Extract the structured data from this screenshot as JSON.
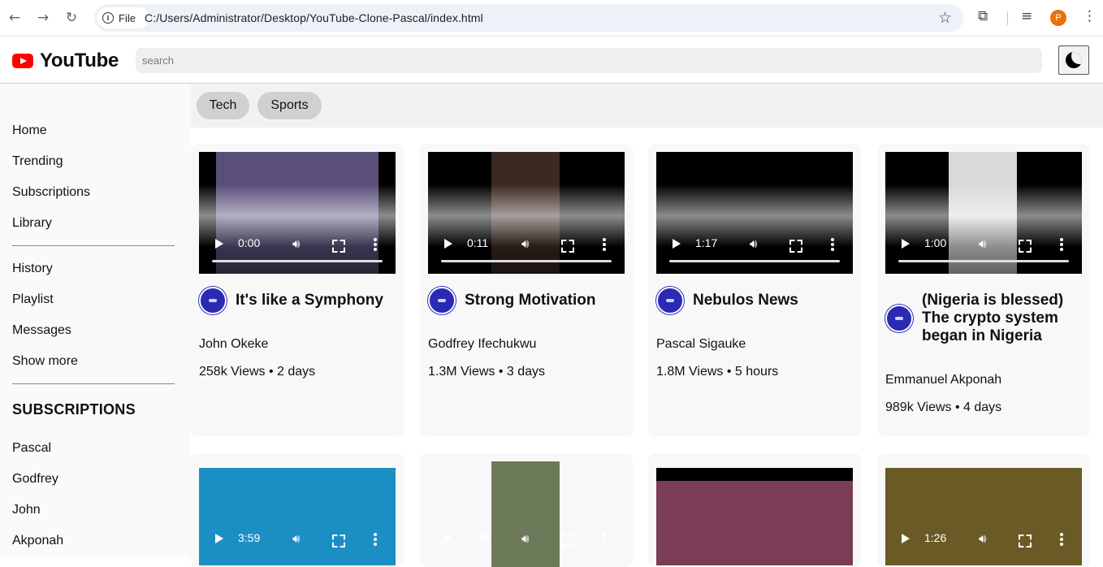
{
  "browser": {
    "file_chip": "File",
    "url": "C:/Users/Administrator/Desktop/YouTube-Clone-Pascal/index.html",
    "profile_initial": "P"
  },
  "header": {
    "brand": "YouTube",
    "search_placeholder": "search"
  },
  "sidebar": {
    "items": [
      "Home",
      "Trending",
      "Subscriptions",
      "Library"
    ],
    "items2": [
      "History",
      "Playlist",
      "Messages",
      "Show more"
    ],
    "subscriptions_heading": "SUBSCRIPTIONS",
    "subscriptions": [
      "Pascal",
      "Godfrey",
      "John",
      "Akponah"
    ]
  },
  "categories": [
    "Tech",
    "Sports"
  ],
  "videos": [
    {
      "time": "0:00",
      "title": "It's like a Symphony",
      "channel": "John Okeke",
      "meta": "258k Views • 2 days",
      "thumb_color": "#5a4f7a"
    },
    {
      "time": "0:11",
      "title": "Strong Motivation",
      "channel": "Godfrey Ifechukwu",
      "meta": "1.3M Views • 3 days",
      "thumb_color": "#3b2a22"
    },
    {
      "time": "1:17",
      "title": "Nebulos News",
      "channel": "Pascal Sigauke",
      "meta": "1.8M Views • 5 hours",
      "thumb_color": "#000000"
    },
    {
      "time": "1:00",
      "title": "(Nigeria is blessed) The crypto system began in Nigeria",
      "channel": "Emmanuel Akponah",
      "meta": "989k Views • 4 days",
      "thumb_color": "#d9d9d9"
    },
    {
      "time": "3:59",
      "thumb_color": "#1b8fc4"
    },
    {
      "time": "0:38",
      "thumb_color": "#6d7a5a"
    },
    {
      "time": "",
      "thumb_color": "#7a3d55"
    },
    {
      "time": "1:26",
      "thumb_color": "#6a5a25"
    }
  ],
  "colors": {
    "brand_red": "#ff0000",
    "avatar_blue": "#2a2ab5"
  }
}
